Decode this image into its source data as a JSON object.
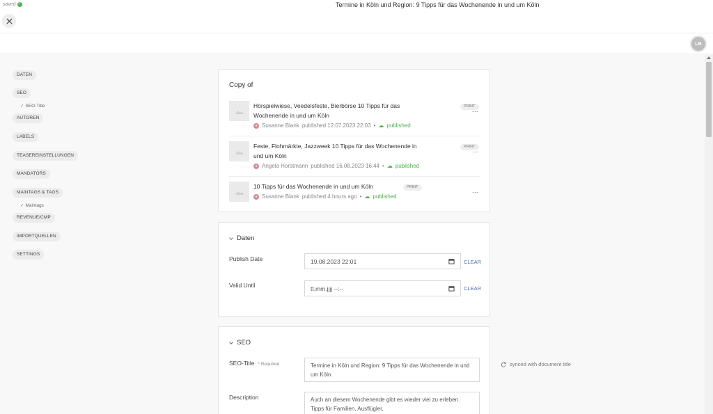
{
  "header": {
    "saved_label": "saved",
    "document_title": "Termine in Köln und Region: 9 Tipps für das Wochenende in und um Köln",
    "user_initials": "LB"
  },
  "sidebar": {
    "items": [
      {
        "label": "DATEN"
      },
      {
        "label": "SEO"
      },
      {
        "label": "SEO-Title",
        "sub": true
      },
      {
        "label": "AUTOREN"
      },
      {
        "label": "LABELS"
      },
      {
        "label": "TEASEREINSTELLUNGEN"
      },
      {
        "label": "MANDATORS"
      },
      {
        "label": "MAINTAGS & TAGS"
      },
      {
        "label": "Maintags",
        "sub": true
      },
      {
        "label": "REVENUE/CMP"
      },
      {
        "label": "IMPORTQUELLEN"
      },
      {
        "label": "SETTINGS"
      }
    ]
  },
  "copy_of": {
    "title": "Copy of",
    "articles": [
      {
        "title": "Hörspielwiese, Veedelsfeste, Bierbörse 10 Tipps für das Wochenende in und um Köln",
        "badge": "PRINT",
        "author": "Susanne Blank",
        "published_text": "published 12.07.2023 22:03",
        "status": "published",
        "more": "..."
      },
      {
        "title": "Feste, Flohmärkte, Jazzweek 10 Tipps für das Wochenende in und um Köln",
        "badge": "PRINT",
        "author": "Angela Horstmann",
        "published_text": "published 16.08.2023 16:44",
        "status": "published",
        "more": "..."
      },
      {
        "title": "10 Tipps für das Wochenende in und um Köln",
        "badge": "PRINT",
        "author": "Susanne Blank",
        "published_text": "published 4 hours ago",
        "status": "published",
        "more": "..."
      }
    ]
  },
  "daten": {
    "heading": "Daten",
    "publish_date_label": "Publish Date",
    "publish_date_value": "19.08.2023  22:01",
    "valid_until_label": "Valid Until",
    "valid_until_value": "tt.mm.jjjj  --:--",
    "clear_label": "CLEAR"
  },
  "seo": {
    "heading": "SEO",
    "title_label": "SEO-Title",
    "required_label": "* Required",
    "title_value": "Termine in Köln und Region: 9 Tipps für das Wochenende in und um Köln",
    "synced_label": "synced with document title",
    "description_label": "Description",
    "description_value": "Auch an diesem Wochenende gibt es wieder viel zu erleben. Tipps für Familien, Ausflügler,"
  },
  "colors": {
    "published": "#4caf50",
    "clear_link": "#4a6fa5"
  }
}
